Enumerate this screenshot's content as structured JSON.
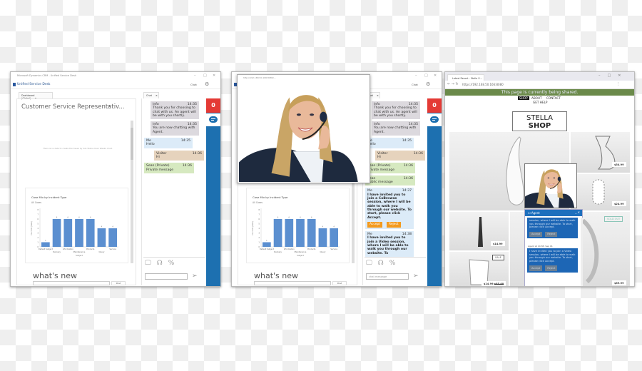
{
  "usd_windows": [
    {
      "title": "Microsoft Dynamics CRM - Unified Service Desk",
      "app_name": "Unified Service Desk",
      "chat_button": "Chat",
      "tabs": [
        {
          "label": "Dashboard (Global)"
        },
        {
          "label": "Chat"
        }
      ],
      "dashboard_title": "Customer Service Representativ...",
      "empty_chart_message": "There is no data to create the Cases by Sub Status Over Weeks chart.",
      "whats_new": "what's new",
      "post_button": "Post",
      "chat_placeholder": "",
      "unread_count": "0",
      "messages": [
        {
          "type": "info",
          "sender": "Info",
          "time": "14:35",
          "text": "Thank you for choosing to chat with us. An agent will be with you shortly."
        },
        {
          "type": "info",
          "sender": "Info",
          "time": "14:35",
          "text": "You are now chatting with Agent."
        },
        {
          "type": "me",
          "sender": "Me",
          "time": "14:35",
          "text": "Hello"
        },
        {
          "type": "visitor",
          "sender": "Visitor",
          "time": "14:36",
          "text": "Hi"
        },
        {
          "type": "green",
          "sender": "Sean (Private)",
          "time": "14:36",
          "text": "Private message"
        }
      ]
    },
    {
      "title": "Microsoft Dynamics CRM - Unified Service Desk",
      "app_name": "Unified Service Desk",
      "chat_button": "Chat",
      "tabs": [
        {
          "label": "Dashboard (Global)"
        },
        {
          "label": "Chat"
        }
      ],
      "dashboard_title": "Customer Service Representativ...",
      "empty_chart_message": "",
      "whats_new": "what's new",
      "post_button": "Post",
      "chat_placeholder": "chat message",
      "unread_count": "0",
      "video_popup_url": "http://192.168.50.166:8080/...",
      "messages": [
        {
          "type": "info",
          "sender": "Info",
          "time": "14:35",
          "text": "Thank you for choosing to chat with us. An agent will be with you shortly."
        },
        {
          "type": "info",
          "sender": "Info",
          "time": "14:35",
          "text": "You are now chatting with Agent."
        },
        {
          "type": "me",
          "sender": "Me",
          "time": "14:35",
          "text": "Hello"
        },
        {
          "type": "visitor",
          "sender": "Visitor",
          "time": "14:36",
          "text": "Hi"
        },
        {
          "type": "green",
          "sender": "Sean (Private)",
          "time": "14:36",
          "text": "Private message"
        },
        {
          "type": "green",
          "sender": "Sean",
          "time": "14:36",
          "text": "Public message"
        },
        {
          "type": "me bold",
          "sender": "Me",
          "time": "14:37",
          "text": "I have invited you to join a CoBrowse session, where I will be able to walk you through our website. To start, please click Accept.",
          "buttons": [
            "Accept",
            "Reject"
          ]
        },
        {
          "type": "me bold",
          "sender": "Me",
          "time": "14:38",
          "text": "I have invited you to join a Video session, where I will be able to walk you through our website. To"
        }
      ]
    }
  ],
  "chart_data": {
    "type": "bar",
    "title": "Case Mix by Incident Type",
    "subtitle": "All Cases",
    "xlabel": "Subject",
    "ylabel": "Count:All (Case)",
    "categories": [
      "Default Subject",
      "Delivery",
      "Information",
      "Maintenance",
      "Products",
      "Query",
      "Service"
    ],
    "values": [
      1,
      6,
      6,
      6,
      6,
      4,
      4
    ],
    "ylim": [
      0,
      8
    ],
    "yticks": [
      "0",
      "1",
      "2",
      "3",
      "4",
      "5",
      "6",
      "7",
      "8"
    ],
    "color": "#5b8fd0",
    "grid": false
  },
  "browser": {
    "tab_title": "Latest Resort - Stella S...",
    "url": "https://192.168.50.166:8080",
    "banner": "This page is currently being shared.",
    "nav": [
      "SHOP",
      "ABOUT",
      "CONTACT",
      "GET HELP"
    ],
    "brand_line1": "STELLA",
    "brand_line2": "SHOP",
    "products": [
      {
        "price": "$34.99"
      },
      {
        "price": "$24.99"
      },
      {
        "price": "$14.99"
      },
      {
        "badge": "SALE",
        "price": "$14.99",
        "old_price": "$65.00"
      },
      {
        "badge": "SOLD OUT",
        "price": "$39.99"
      }
    ],
    "agent_widget": {
      "title": "Agent",
      "msg1": "session, where I will be able to walk you through our website. To start, please click Accept.",
      "meta": "Agent at 14:38, Sep 01",
      "msg2": "I have invited you to join a Video session, where I will be able to walk you through our website. To start, please click Accept.",
      "accept": "Accept",
      "reject": "Reject"
    }
  },
  "colors": {
    "usd_sidebar": "#1d70b0",
    "badge_red": "#e43a35",
    "banner_green": "#6b8a4a",
    "accept_orange": "#f39a1e"
  }
}
